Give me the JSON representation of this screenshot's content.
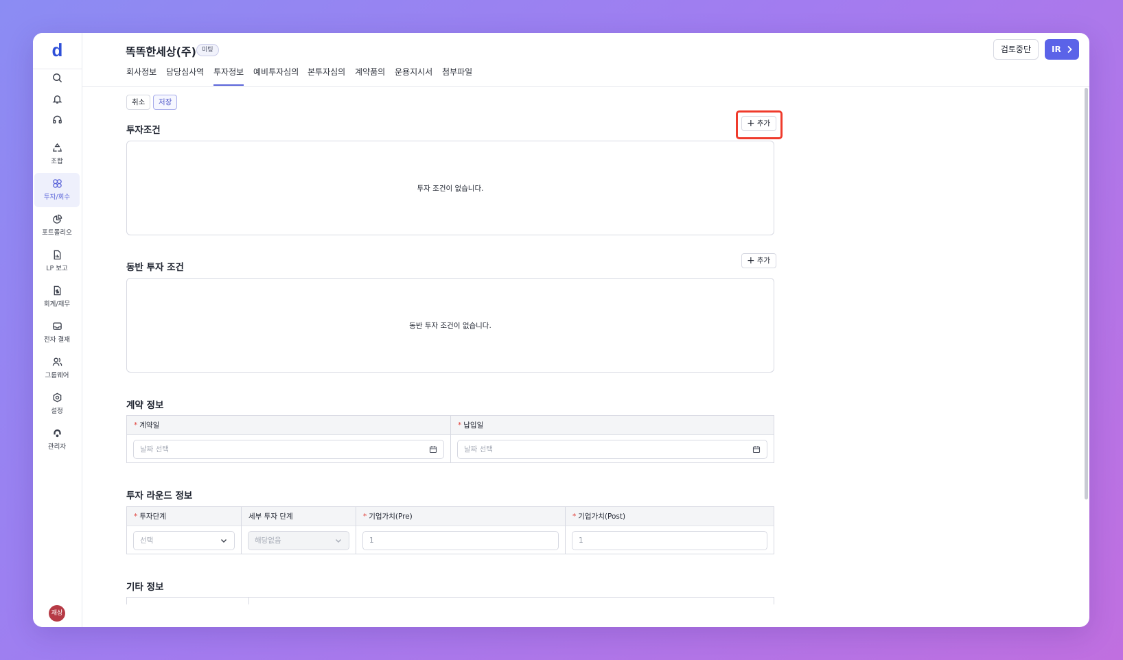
{
  "sidebar": {
    "logo": "d",
    "items": [
      {
        "label": "조합",
        "icon": "recycle-icon"
      },
      {
        "label": "투자/회수",
        "icon": "investment-icon"
      },
      {
        "label": "포트폴리오",
        "icon": "pie-chart-icon"
      },
      {
        "label": "LP 보고",
        "icon": "report-file-icon"
      },
      {
        "label": "회계/재무",
        "icon": "finance-file-icon"
      },
      {
        "label": "전자 결재",
        "icon": "inbox-icon"
      },
      {
        "label": "그룹웨어",
        "icon": "users-icon"
      },
      {
        "label": "설정",
        "icon": "gear-icon"
      },
      {
        "label": "관리자",
        "icon": "admin-icon"
      }
    ],
    "avatar": "재상"
  },
  "header": {
    "company": "똑똑한세상(주)",
    "badge": "미팅",
    "tabs": [
      "회사정보",
      "담당심사역",
      "투자정보",
      "예비투자심의",
      "본투자심의",
      "계약품의",
      "운용지시서",
      "첨부파일"
    ],
    "active_tab": "투자정보",
    "stop_review": "검토중단",
    "ir": "IR"
  },
  "actions": {
    "cancel": "취소",
    "save": "저장"
  },
  "investment_terms": {
    "title": "투자조건",
    "add": "추가",
    "empty": "투자 조건이 없습니다."
  },
  "co_investment": {
    "title": "동반 투자 조건",
    "add": "추가",
    "empty": "동반 투자 조건이 없습니다."
  },
  "contract": {
    "title": "계약 정보",
    "contract_date_label": "계약일",
    "payment_date_label": "납입일",
    "date_placeholder": "날짜 선택"
  },
  "round": {
    "title": "투자 라운드 정보",
    "stage_label": "투자단계",
    "sub_stage_label": "세부 투자 단계",
    "pre_label": "기업가치(Pre)",
    "post_label": "기업가치(Post)",
    "stage_value": "선택",
    "sub_stage_value": "해당없음",
    "pre_value": "1",
    "post_value": "1"
  },
  "other": {
    "title": "기타 정보"
  },
  "colors": {
    "accent": "#5b63e8",
    "highlight": "#ef3b2c",
    "required": "#e0403a"
  }
}
